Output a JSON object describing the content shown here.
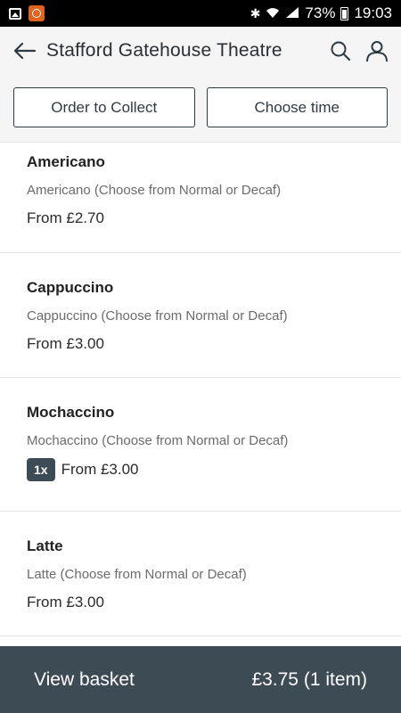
{
  "status_bar": {
    "battery": "73%",
    "time": "19:03"
  },
  "header": {
    "title": "Stafford Gatehouse Theatre",
    "order_button": "Order to Collect",
    "time_button": "Choose time"
  },
  "items": [
    {
      "name": "Americano",
      "description": "Americano (Choose from Normal or Decaf)",
      "price": "From £2.70",
      "quantity": ""
    },
    {
      "name": "Cappuccino",
      "description": "Cappuccino (Choose from Normal or Decaf)",
      "price": "From £3.00",
      "quantity": ""
    },
    {
      "name": "Mochaccino",
      "description": "Mochaccino (Choose from Normal or Decaf)",
      "price": "From £3.00",
      "quantity": "1x"
    },
    {
      "name": "Latte",
      "description": "Latte (Choose from Normal or Decaf)",
      "price": "From £3.00",
      "quantity": ""
    }
  ],
  "basket": {
    "label": "View basket",
    "total": "£3.75 (1 item)"
  },
  "colors": {
    "bar": "#3d4b55",
    "badge": "#3c4b55",
    "header_bg": "#f5f5f5"
  }
}
